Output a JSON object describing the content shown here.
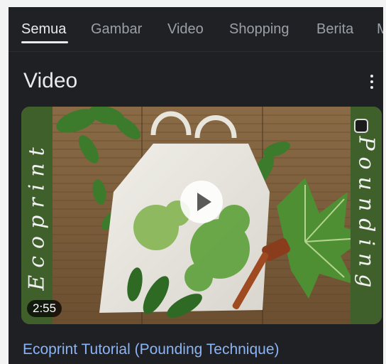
{
  "tabs": [
    {
      "label": "Semua",
      "active": true
    },
    {
      "label": "Gambar",
      "active": false
    },
    {
      "label": "Video",
      "active": false
    },
    {
      "label": "Shopping",
      "active": false
    },
    {
      "label": "Berita",
      "active": false
    },
    {
      "label": "M",
      "active": false
    }
  ],
  "section": {
    "title": "Video",
    "menu_icon": "more-vert-icon"
  },
  "video": {
    "thumbnail_left_text": "Ecoprint",
    "thumbnail_right_text": "Pounding",
    "duration": "2:55",
    "title": "Ecoprint Tutorial (Pounding Technique)",
    "play_icon": "play-icon"
  },
  "colors": {
    "background": "#1f2023",
    "tab_active": "#e8eaed",
    "tab_inactive": "#9aa0a6",
    "link": "#8ab4f8",
    "side_panel": "#3f5f2b"
  }
}
